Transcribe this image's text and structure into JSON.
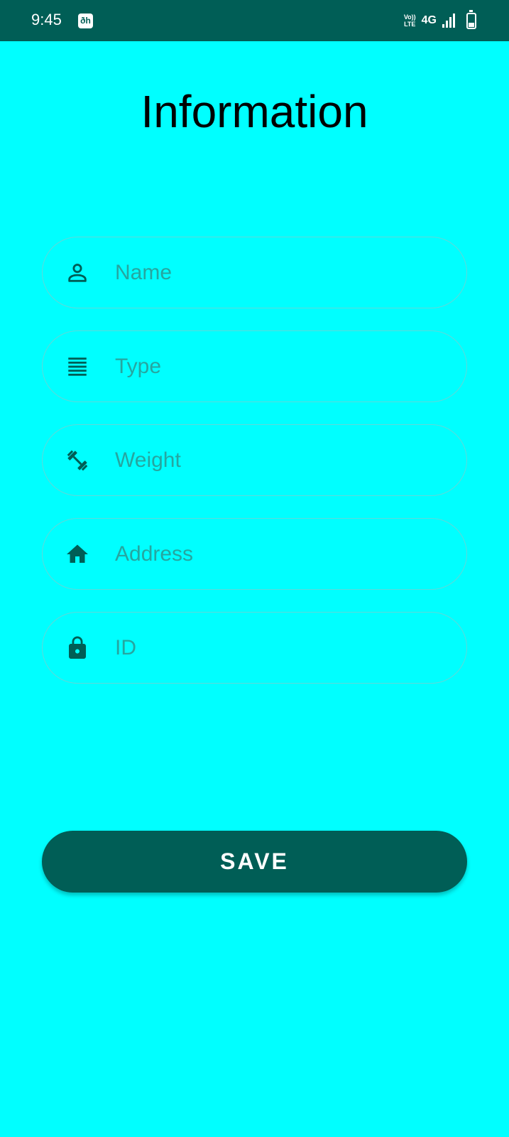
{
  "status_bar": {
    "time": "9:45",
    "app_badge": "ðh",
    "volte_top": "Vo))",
    "volte_bottom": "LTE",
    "network": "4G",
    "signal_bars": 4,
    "icons": [
      "signal-icon",
      "battery-icon"
    ]
  },
  "header": {
    "title": "Information"
  },
  "form": {
    "fields": [
      {
        "placeholder": "Name",
        "value": "",
        "icon": "person-icon"
      },
      {
        "placeholder": "Type",
        "value": "",
        "icon": "list-icon"
      },
      {
        "placeholder": "Weight",
        "value": "",
        "icon": "dumbbell-icon"
      },
      {
        "placeholder": "Address",
        "value": "",
        "icon": "home-icon"
      },
      {
        "placeholder": "ID",
        "value": "",
        "icon": "lock-icon"
      }
    ],
    "save_label": "SAVE"
  },
  "colors": {
    "background": "#00FFFF",
    "accent": "#005E56",
    "placeholder": "#26A6A0",
    "field_border": "#5FD9D9"
  }
}
